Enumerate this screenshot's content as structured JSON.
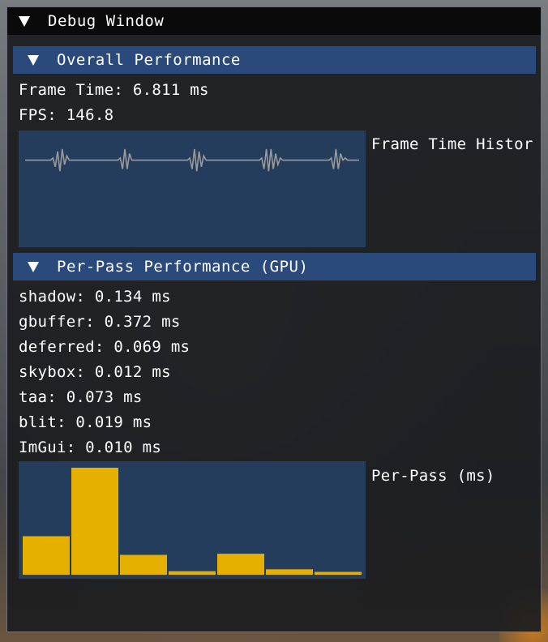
{
  "window": {
    "title": "Debug Window"
  },
  "overall": {
    "header": "Overall Performance",
    "frame_time": "Frame Time: 6.811 ms",
    "fps": "FPS: 146.8",
    "plot_label": "Frame Time Histor"
  },
  "per_pass": {
    "header": "Per-Pass Performance (GPU)",
    "lines": [
      "shadow: 0.134 ms",
      "gbuffer: 0.372 ms",
      "deferred: 0.069 ms",
      "skybox: 0.012 ms",
      "taa: 0.073 ms",
      "blit: 0.019 ms",
      "ImGui: 0.010 ms"
    ],
    "plot_label": "Per-Pass (ms)"
  },
  "colors": {
    "header_bg": "#294a7a",
    "plot_bg": "#253d5c",
    "line_color": "#9a9a9a",
    "bar_color": "#e6b000"
  },
  "chart_data": [
    {
      "type": "line",
      "title": "Frame Time Histor",
      "series": [
        {
          "values": [
            6.8,
            6.8,
            6.8,
            6.8,
            6.8,
            6.8,
            6.8,
            6.8,
            6.8,
            6.8,
            6.8,
            6.8,
            6.9,
            6.5,
            7.2,
            6.3,
            7.3,
            6.6,
            7.0,
            6.8,
            6.8,
            6.8,
            6.8,
            6.8,
            6.8,
            6.8,
            6.8,
            6.8,
            6.8,
            6.8,
            6.8,
            6.8,
            6.8,
            6.8,
            6.8,
            6.8,
            6.8,
            6.8,
            6.8,
            6.8,
            6.8,
            6.9,
            6.4,
            7.3,
            6.4,
            7.1,
            6.8,
            6.8,
            6.8,
            6.8,
            6.8,
            6.8,
            6.8,
            6.8,
            6.8,
            6.8,
            6.8,
            6.8,
            6.8,
            6.8,
            6.8,
            6.8,
            6.8,
            6.8,
            6.8,
            6.8,
            6.8,
            6.8,
            6.8,
            6.8,
            6.8,
            6.9,
            6.4,
            7.3,
            6.3,
            7.2,
            6.5,
            7.0,
            6.8,
            6.8,
            6.8,
            6.8,
            6.8,
            6.8,
            6.8,
            6.8,
            6.8,
            6.8,
            6.8,
            6.8,
            6.8,
            6.8,
            6.8,
            6.8,
            6.8,
            6.8,
            6.8,
            6.8,
            6.8,
            6.8,
            6.8,
            6.8,
            6.9,
            6.4,
            7.3,
            6.3,
            7.3,
            6.4,
            7.1,
            6.6,
            6.9,
            6.8,
            6.8,
            6.8,
            6.8,
            6.8,
            6.8,
            6.8,
            6.8,
            6.8,
            6.8,
            6.8,
            6.8,
            6.8,
            6.8,
            6.8,
            6.8,
            6.8,
            6.8,
            6.8,
            6.8,
            6.8,
            6.9,
            6.4,
            7.3,
            6.4,
            7.1,
            6.8,
            6.9,
            6.8,
            6.8,
            6.8,
            6.8,
            6.8,
            6.8
          ]
        }
      ],
      "ylim": [
        3,
        8
      ]
    },
    {
      "type": "bar",
      "title": "Per-Pass (ms)",
      "categories": [
        "shadow",
        "gbuffer",
        "deferred",
        "skybox",
        "taa",
        "blit",
        "ImGui"
      ],
      "values": [
        0.134,
        0.372,
        0.069,
        0.012,
        0.073,
        0.019,
        0.01
      ],
      "ylim": [
        0,
        0.372
      ]
    }
  ]
}
